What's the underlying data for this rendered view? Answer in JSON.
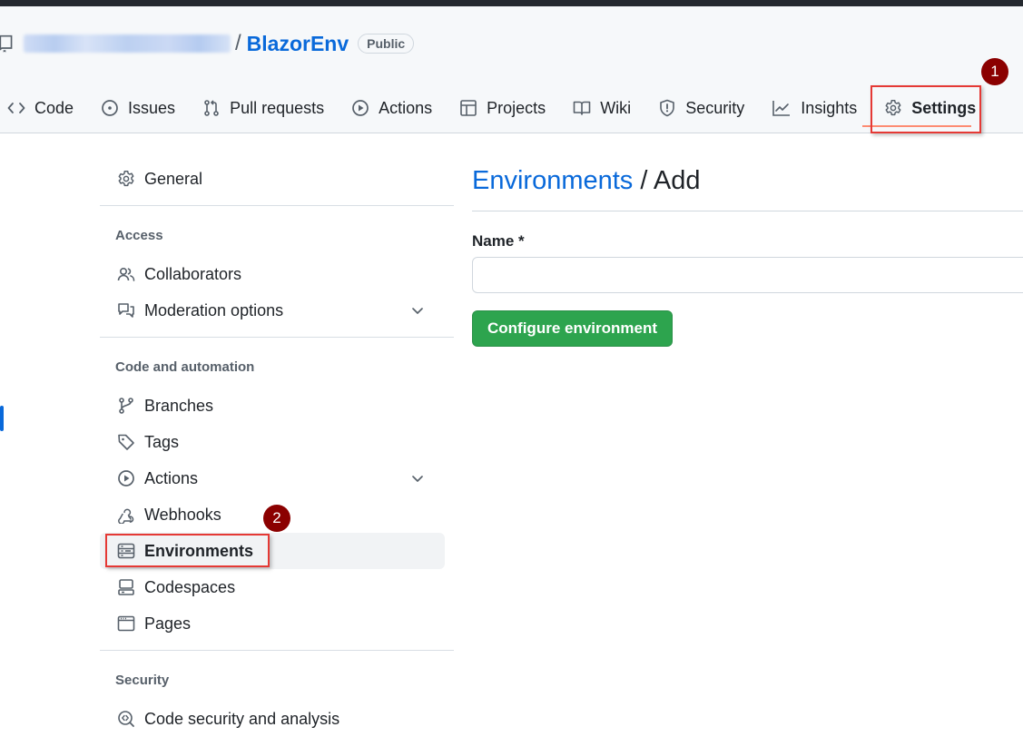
{
  "repo": {
    "owner_redacted": true,
    "separator": "/",
    "name": "BlazorEnv",
    "visibility_badge": "Public"
  },
  "nav_tabs": [
    {
      "label": "Code",
      "icon": "code-icon",
      "selected": false
    },
    {
      "label": "Issues",
      "icon": "issue-opened-icon",
      "selected": false
    },
    {
      "label": "Pull requests",
      "icon": "git-pull-request-icon",
      "selected": false
    },
    {
      "label": "Actions",
      "icon": "play-icon",
      "selected": false
    },
    {
      "label": "Projects",
      "icon": "table-icon",
      "selected": false
    },
    {
      "label": "Wiki",
      "icon": "book-icon",
      "selected": false
    },
    {
      "label": "Security",
      "icon": "shield-icon",
      "selected": false
    },
    {
      "label": "Insights",
      "icon": "graph-icon",
      "selected": false
    },
    {
      "label": "Settings",
      "icon": "gear-icon",
      "selected": true
    }
  ],
  "sidebar": {
    "general": {
      "label": "General",
      "icon": "gear-icon"
    },
    "sections": [
      {
        "heading": "Access",
        "items": [
          {
            "label": "Collaborators",
            "icon": "people-icon",
            "expandable": false
          },
          {
            "label": "Moderation options",
            "icon": "comment-discussion-icon",
            "expandable": true
          }
        ]
      },
      {
        "heading": "Code and automation",
        "items": [
          {
            "label": "Branches",
            "icon": "git-branch-icon",
            "expandable": false
          },
          {
            "label": "Tags",
            "icon": "tag-icon",
            "expandable": false
          },
          {
            "label": "Actions",
            "icon": "play-icon",
            "expandable": true
          },
          {
            "label": "Webhooks",
            "icon": "webhook-icon",
            "expandable": false
          },
          {
            "label": "Environments",
            "icon": "server-icon",
            "expandable": false,
            "active": true
          },
          {
            "label": "Codespaces",
            "icon": "codespaces-icon",
            "expandable": false
          },
          {
            "label": "Pages",
            "icon": "browser-icon",
            "expandable": false
          }
        ]
      },
      {
        "heading": "Security",
        "items": [
          {
            "label": "Code security and analysis",
            "icon": "codescan-icon",
            "expandable": false
          }
        ]
      }
    ]
  },
  "main": {
    "breadcrumb_link": "Environments",
    "breadcrumb_sep": " / ",
    "breadcrumb_current": "Add",
    "name_label": "Name *",
    "name_value": "",
    "name_placeholder": "",
    "submit_label": "Configure environment"
  },
  "annotations": [
    {
      "number": "1",
      "target": "Settings tab"
    },
    {
      "number": "2",
      "target": "Environments sidebar item"
    }
  ],
  "colors": {
    "link": "#0969da",
    "primary_button": "#2da44e",
    "annotation_box": "#e53935",
    "annotation_badge": "#8b0000",
    "active_indicator": "#0969da",
    "selected_tab_underline": "#fd8c73"
  }
}
